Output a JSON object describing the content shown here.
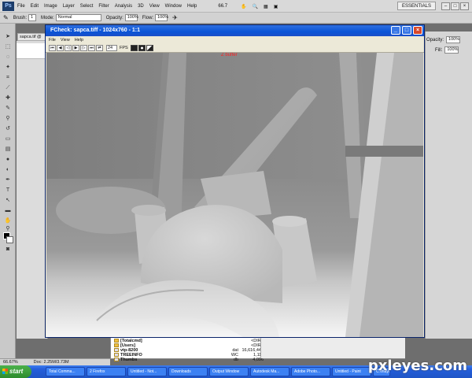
{
  "ps": {
    "logo": "Ps",
    "menu": [
      "File",
      "Edit",
      "Image",
      "Layer",
      "Select",
      "Filter",
      "Analysis",
      "3D",
      "View",
      "Window",
      "Help"
    ],
    "zoom_readout": "66.7",
    "workspace": "ESSENTIALS",
    "options": {
      "brush_label": "Brush:",
      "brush_size": "1",
      "mode_label": "Mode:",
      "mode_value": "Normal",
      "opacity_label": "Opacity:",
      "opacity_value": "100%",
      "flow_label": "Flow:",
      "flow_value": "100%"
    },
    "doc_tab": "sapca.tif @",
    "right_panel": {
      "opacity_label": "Opacity:",
      "opacity_value": "100%",
      "fill_label": "Fill:",
      "fill_value": "100%"
    },
    "status": {
      "zoom": "66.67%",
      "doc": "Doc: 2.25M/3.73M"
    }
  },
  "fcheck": {
    "title": "FCheck: sapca.tiff - 1024x760 - 1:1",
    "menu": [
      "File",
      "View",
      "Help"
    ],
    "fps_value": "24",
    "fps_label": "FPS",
    "buffer_label": "Z buffer"
  },
  "filemgr": {
    "rows": [
      {
        "name": "[Totalcmd]",
        "size": "<DIR>",
        "type": ""
      },
      {
        "name": "[Users]",
        "size": "<DIR>",
        "type": ""
      },
      {
        "name": "vtp-8200",
        "size": "16,616,448",
        "type": "dat"
      },
      {
        "name": "TREEINFO",
        "size": "1,111",
        "type": "WC"
      },
      {
        "name": "Thumbs",
        "size": "4,096",
        "type": "db"
      }
    ]
  },
  "taskbar": {
    "start": "start",
    "tasks": [
      "Total Comma...",
      "2 Firefox",
      "Untitled - Not...",
      "Downloads",
      "Output Window",
      "Autodesk Ma...",
      "Adobe Photo...",
      "Untitled - Paint",
      "C:\\maya bak"
    ]
  },
  "watermark": "pxleyes.com"
}
